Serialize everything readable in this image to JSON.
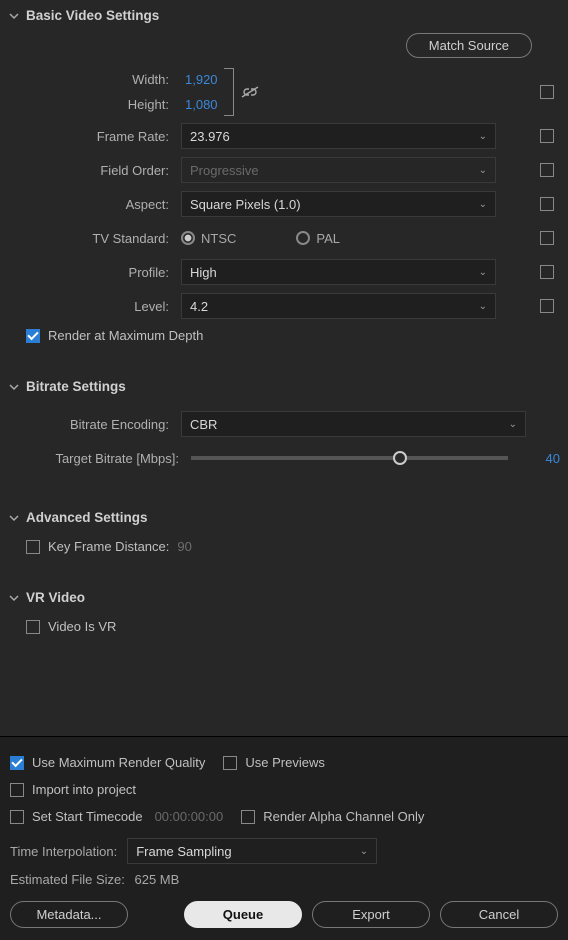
{
  "basic": {
    "title": "Basic Video Settings",
    "matchSource": "Match Source",
    "widthLabel": "Width:",
    "widthValue": "1,920",
    "heightLabel": "Height:",
    "heightValue": "1,080",
    "frameRateLabel": "Frame Rate:",
    "frameRateValue": "23.976",
    "fieldOrderLabel": "Field Order:",
    "fieldOrderValue": "Progressive",
    "aspectLabel": "Aspect:",
    "aspectValue": "Square Pixels (1.0)",
    "tvStdLabel": "TV Standard:",
    "tvNtsc": "NTSC",
    "tvPal": "PAL",
    "profileLabel": "Profile:",
    "profileValue": "High",
    "levelLabel": "Level:",
    "levelValue": "4.2",
    "renderMaxDepth": "Render at Maximum Depth"
  },
  "bitrate": {
    "title": "Bitrate Settings",
    "encodingLabel": "Bitrate Encoding:",
    "encodingValue": "CBR",
    "targetLabel": "Target Bitrate [Mbps]:",
    "targetValue": "40"
  },
  "advanced": {
    "title": "Advanced Settings",
    "keyFrameLabel": "Key Frame Distance:",
    "keyFrameValue": "90"
  },
  "vr": {
    "title": "VR Video",
    "isVrLabel": "Video Is VR"
  },
  "bottom": {
    "maxRender": "Use Maximum Render Quality",
    "usePreviews": "Use Previews",
    "importProject": "Import into project",
    "setStartTC": "Set Start Timecode",
    "tcValue": "00:00:00:00",
    "renderAlpha": "Render Alpha Channel Only",
    "timeInterpLabel": "Time Interpolation:",
    "timeInterpValue": "Frame Sampling",
    "estLabel": "Estimated File Size:",
    "estValue": "625 MB",
    "metadata": "Metadata...",
    "queue": "Queue",
    "export": "Export",
    "cancel": "Cancel"
  }
}
